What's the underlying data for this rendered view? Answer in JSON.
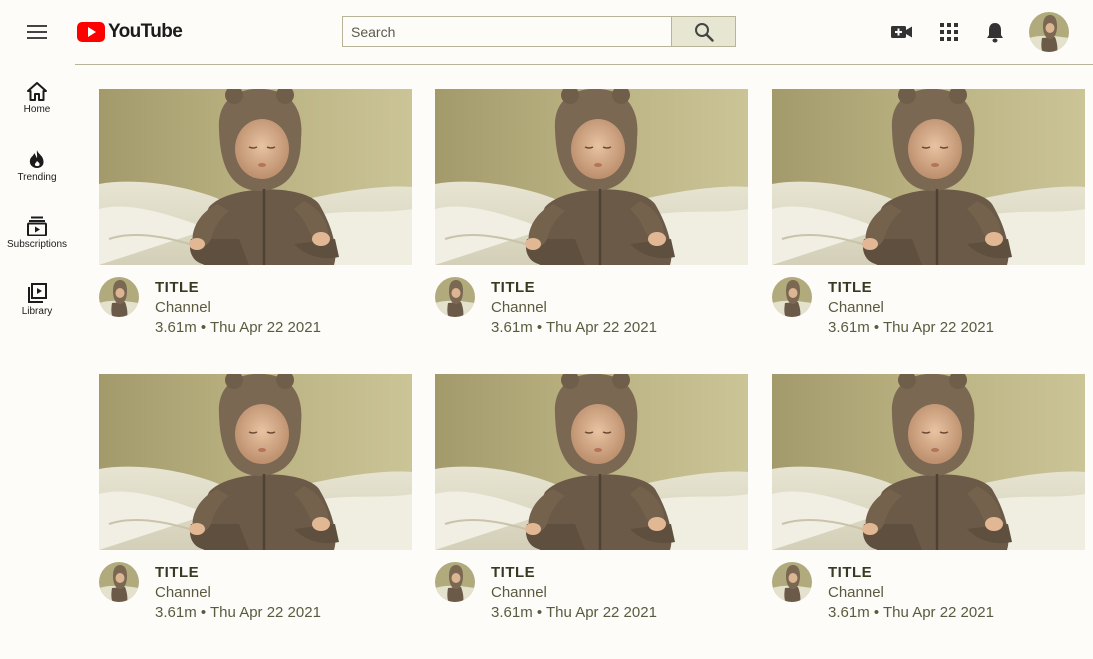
{
  "header": {
    "logo_text": "YouTube",
    "search_placeholder": "Search",
    "search_value": "",
    "icons": [
      "menu-icon",
      "youtube-logo-icon",
      "search-icon",
      "create-video-icon",
      "apps-grid-icon",
      "bell-icon",
      "user-avatar"
    ],
    "colors": {
      "brand_red": "#ff0000",
      "search_button_bg": "#e7e6d3",
      "page_bg": "#fdfcf9"
    }
  },
  "sidebar": {
    "items": [
      {
        "label": "Home",
        "icon": "home-icon"
      },
      {
        "label": "Trending",
        "icon": "fire-icon"
      },
      {
        "label": "Subscriptions",
        "icon": "subscriptions-icon"
      },
      {
        "label": "Library",
        "icon": "library-icon"
      }
    ]
  },
  "videos": [
    {
      "title": "TITLE",
      "channel": "Channel",
      "views": "3.61m",
      "date": "Thu Apr 22 2021",
      "meta": "3.61m • Thu Apr 22 2021"
    },
    {
      "title": "TITLE",
      "channel": "Channel",
      "views": "3.61m",
      "date": "Thu Apr 22 2021",
      "meta": "3.61m • Thu Apr 22 2021"
    },
    {
      "title": "TITLE",
      "channel": "Channel",
      "views": "3.61m",
      "date": "Thu Apr 22 2021",
      "meta": "3.61m • Thu Apr 22 2021"
    },
    {
      "title": "TITLE",
      "channel": "Channel",
      "views": "3.61m",
      "date": "Thu Apr 22 2021",
      "meta": "3.61m • Thu Apr 22 2021"
    },
    {
      "title": "TITLE",
      "channel": "Channel",
      "views": "3.61m",
      "date": "Thu Apr 22 2021",
      "meta": "3.61m • Thu Apr 22 2021"
    },
    {
      "title": "TITLE",
      "channel": "Channel",
      "views": "3.61m",
      "date": "Thu Apr 22 2021",
      "meta": "3.61m • Thu Apr 22 2021"
    }
  ]
}
